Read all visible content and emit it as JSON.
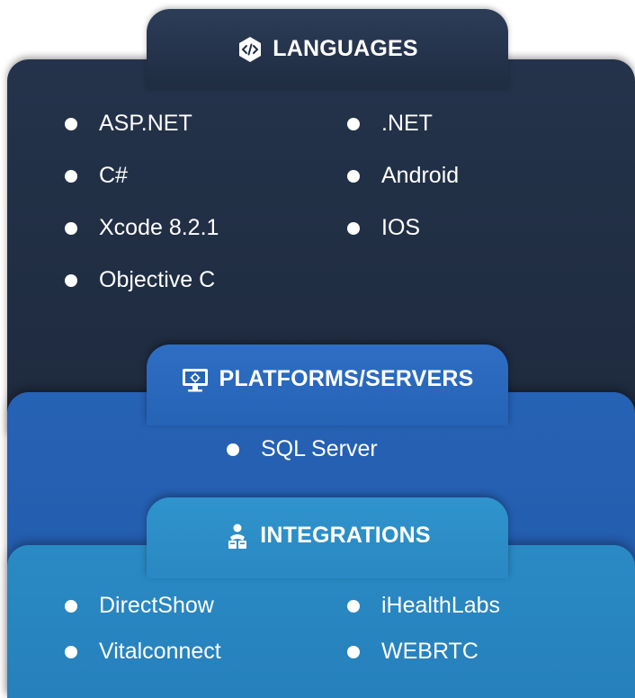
{
  "languages": {
    "title": "LANGUAGES",
    "icon": "code-icon",
    "left_items": [
      "ASP.NET",
      "C#",
      "Xcode 8.2.1",
      "Objective C"
    ],
    "right_items": [
      ".NET",
      "Android",
      "IOS"
    ]
  },
  "platforms": {
    "title": "PLATFORMS/SERVERS",
    "icon": "server-monitor-icon",
    "items": [
      "SQL Server"
    ]
  },
  "integrations": {
    "title": "INTEGRATIONS",
    "icon": "integration-person-icon",
    "left_items": [
      "DirectShow",
      "Vitalconnect"
    ],
    "right_items": [
      "iHealthLabs",
      "WEBRTC"
    ]
  },
  "colors": {
    "languages_bg": "#1f2c41",
    "platforms_bg": "#2563b5",
    "integrations_bg": "#2a88c2",
    "text": "#ffffff"
  }
}
